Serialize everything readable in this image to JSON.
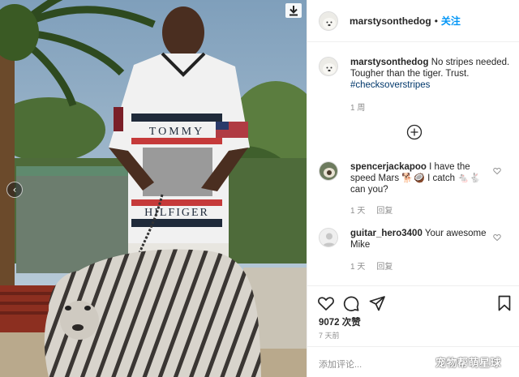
{
  "post": {
    "username": "marstysonthedog",
    "separator": "•",
    "follow_label": "关注"
  },
  "photo": {
    "shirt_top_text": "TOMMY",
    "shirt_bottom_text": "HILFIGER",
    "prev_icon": "chevron-left-icon",
    "download_icon": "download-icon"
  },
  "caption": {
    "username": "marstysonthedog",
    "text": " No stripes needed. Tougher than the tiger. Trust. ",
    "hashtag": "#checksoverstripes",
    "time": "1 周"
  },
  "load_more_icon": "plus-circle-icon",
  "comments": [
    {
      "username": "spencerjackapoo",
      "text": " I have the speed Mars 🐕🥥 I catch 🐁🐇 can you?",
      "time": "1 天",
      "reply_label": "回复"
    },
    {
      "username": "guitar_hero3400",
      "text": " Your awesome Mike",
      "time": "1 天",
      "reply_label": "回复"
    }
  ],
  "actions": {
    "icons": [
      "heart-icon",
      "comment-icon",
      "share-icon",
      "bookmark-icon"
    ],
    "likes": "9072 次赞",
    "posted": "7 天前",
    "add_comment_placeholder": "添加评论..."
  },
  "watermark": "宠物帮萌星球",
  "colors": {
    "follow": "#0095f6",
    "hashtag": "#00376b",
    "muted": "#8e8e8e",
    "divider": "#efefef"
  }
}
